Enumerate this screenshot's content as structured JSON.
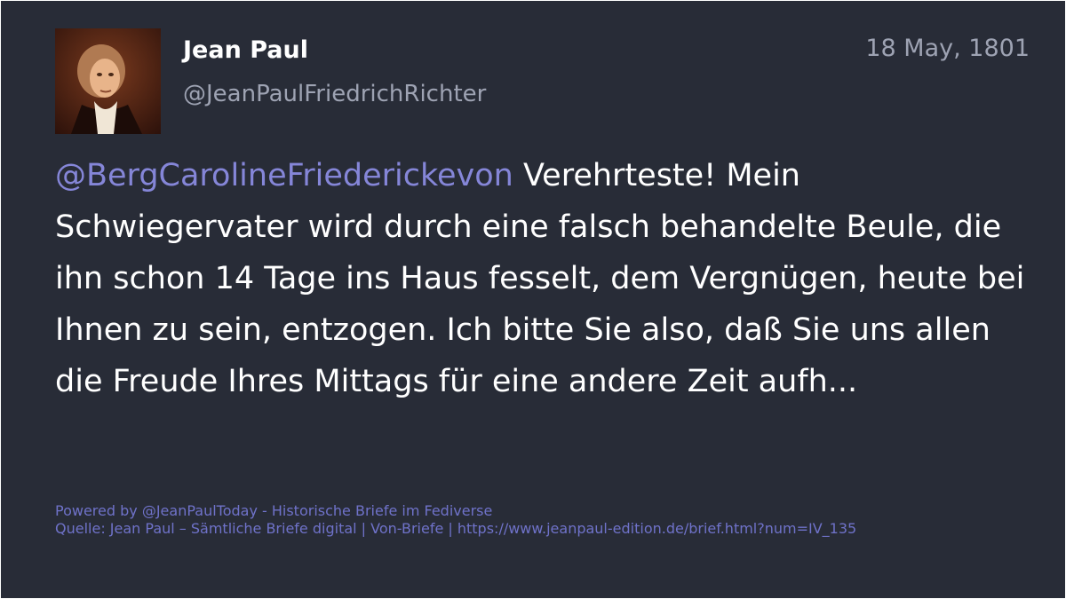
{
  "post": {
    "author_name": "Jean Paul",
    "author_handle": "@JeanPaulFriedrichRichter",
    "date": "18 May, 1801",
    "mention": "@BergCarolineFriederickevon",
    "text": " Verehrteste! Mein Schwiegervater wird durch eine falsch behandelte Beule, die ihn schon 14 Tage ins Haus fesselt, dem Vergnügen, heute bei Ihnen zu sein, entzogen. Ich bitte Sie also, daß Sie uns allen die Freude Ihres Mittags für eine andere Zeit aufh..."
  },
  "footer": {
    "powered_by": "Powered by @JeanPaulToday - Historische Briefe im Fediverse",
    "source": "Quelle: Jean Paul – Sämtliche Briefe digital | Von-Briefe | https://www.jeanpaul-edition.de/brief.html?num=IV_135"
  },
  "colors": {
    "background": "#282c37",
    "mention": "#8586d8",
    "muted": "#9ea3b3",
    "footer": "#6f72c9"
  },
  "icons": {
    "avatar": "portrait-avatar"
  }
}
